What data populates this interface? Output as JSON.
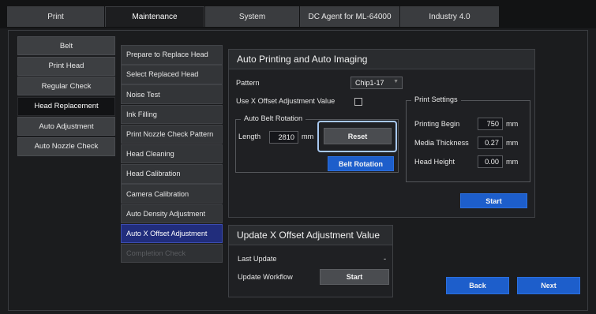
{
  "tabs": [
    {
      "label": "Print",
      "active": false
    },
    {
      "label": "Maintenance",
      "active": true
    },
    {
      "label": "System",
      "active": false
    },
    {
      "label": "DC Agent for ML-64000",
      "active": false
    },
    {
      "label": "Industry 4.0",
      "active": false
    }
  ],
  "sidebar": {
    "items": [
      {
        "label": "Belt"
      },
      {
        "label": "Print Head"
      },
      {
        "label": "Regular Check"
      },
      {
        "label": "Head Replacement",
        "active": true
      },
      {
        "label": "Auto Adjustment"
      },
      {
        "label": "Auto Nozzle Check"
      }
    ]
  },
  "subnav": {
    "items": [
      {
        "label": "Prepare to Replace Head"
      },
      {
        "label": "Select Replaced Head"
      },
      {
        "label": "Noise Test"
      },
      {
        "label": "Ink Filling"
      },
      {
        "label": "Print Nozzle Check Pattern"
      },
      {
        "label": "Head Cleaning"
      },
      {
        "label": "Head Calibration"
      },
      {
        "label": "Camera Calibration"
      },
      {
        "label": "Auto Density Adjustment"
      },
      {
        "label": "Auto X Offset Adjustment",
        "active": true
      },
      {
        "label": "Completion Check",
        "disabled": true
      }
    ]
  },
  "auto_panel": {
    "title": "Auto Printing and Auto Imaging",
    "pattern_label": "Pattern",
    "pattern_value": "Chip1-17",
    "use_x_offset_label": "Use X Offset Adjustment Value",
    "use_x_offset_checked": false,
    "belt_rotation": {
      "group_title": "Auto Belt Rotation",
      "length_label": "Length",
      "length_value": "2810",
      "length_unit": "mm",
      "reset_label": "Reset",
      "belt_rotation_label": "Belt Rotation"
    },
    "print_settings": {
      "group_title": "Print Settings",
      "printing_begin_label": "Printing Begin",
      "printing_begin_value": "750",
      "printing_begin_unit": "mm",
      "media_thickness_label": "Media Thickness",
      "media_thickness_value": "0.27",
      "media_thickness_unit": "mm",
      "head_height_label": "Head Height",
      "head_height_value": "0.00",
      "head_height_unit": "mm"
    },
    "start_label": "Start"
  },
  "update_panel": {
    "title": "Update X Offset Adjustment Value",
    "last_update_label": "Last Update",
    "last_update_value": "-",
    "update_workflow_label": "Update Workflow",
    "start_label": "Start"
  },
  "footer": {
    "back_label": "Back",
    "next_label": "Next"
  },
  "colors": {
    "accent_blue": "#1d5ecb",
    "active_subnav": "#212d7c",
    "highlight": "#a8c8f0"
  }
}
